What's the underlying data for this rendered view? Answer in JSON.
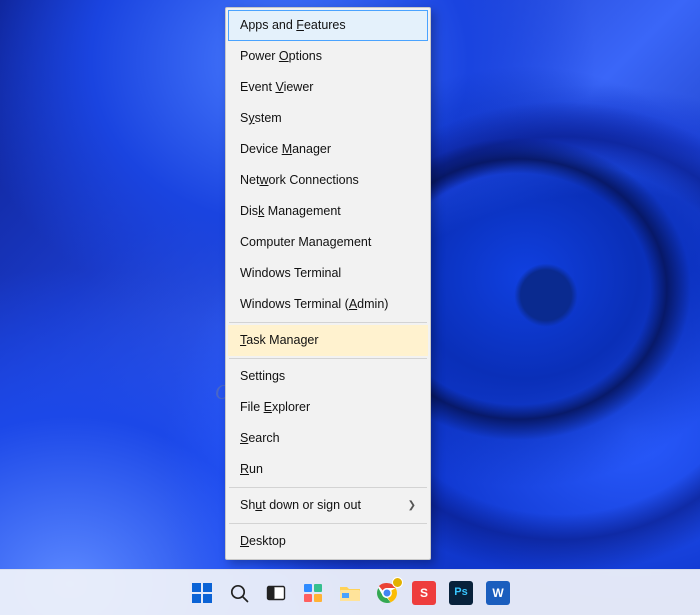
{
  "watermark": "OneNineSpace.com",
  "menu": {
    "items": [
      {
        "pre": "Apps and ",
        "u": "F",
        "post": "eatures",
        "focused": true
      },
      {
        "pre": "Power ",
        "u": "O",
        "post": "ptions"
      },
      {
        "pre": "Event ",
        "u": "V",
        "post": "iewer"
      },
      {
        "pre": "S",
        "u": "y",
        "post": "stem"
      },
      {
        "pre": "Device ",
        "u": "M",
        "post": "anager"
      },
      {
        "pre": "Net",
        "u": "w",
        "post": "ork Connections"
      },
      {
        "pre": "Dis",
        "u": "k",
        "post": " Management"
      },
      {
        "pre": "Computer Mana",
        "u": "g",
        "post": "ement"
      },
      {
        "pre": "Windows Terminal ",
        "u": "",
        "post": ""
      },
      {
        "pre": "Windows Terminal (",
        "u": "A",
        "post": "dmin)"
      },
      {
        "sep": true
      },
      {
        "pre": "",
        "u": "T",
        "post": "ask Manager",
        "highlight": true
      },
      {
        "sep": true
      },
      {
        "pre": "Settings",
        "u": "",
        "post": ""
      },
      {
        "pre": "File ",
        "u": "E",
        "post": "xplorer"
      },
      {
        "pre": "",
        "u": "S",
        "post": "earch"
      },
      {
        "pre": "",
        "u": "R",
        "post": "un"
      },
      {
        "sep": true
      },
      {
        "pre": "Sh",
        "u": "u",
        "post": "t down or sign out",
        "submenu": true
      },
      {
        "sep": true
      },
      {
        "pre": "",
        "u": "D",
        "post": "esktop"
      }
    ]
  },
  "taskbar": {
    "icons": [
      "start",
      "search",
      "task-view",
      "widgets",
      "explorer",
      "chrome",
      "snagit",
      "photoshop",
      "word"
    ]
  }
}
